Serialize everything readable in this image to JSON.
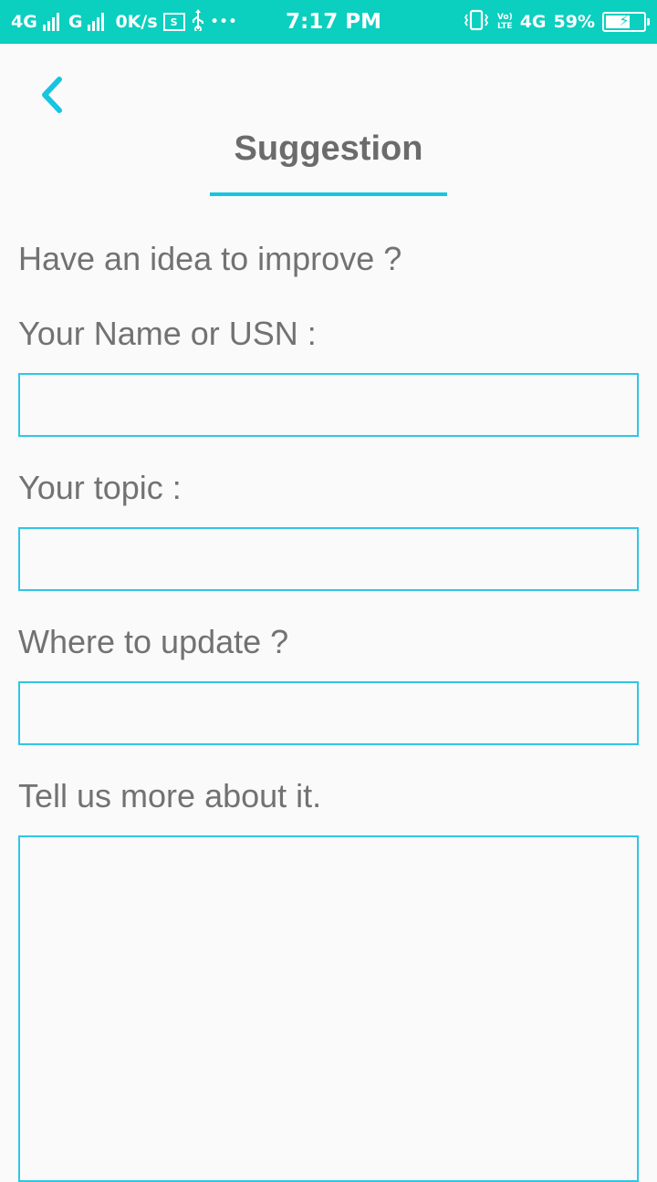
{
  "status_bar": {
    "network1": "4G",
    "network2": "G",
    "speed": "0K/s",
    "sim_label": "S",
    "more": "•••",
    "time": "7:17 PM",
    "volte_top": "Vo)",
    "volte_bottom": "LTE",
    "network3": "4G",
    "battery": "59%"
  },
  "header": {
    "back_icon": "chevron-left-icon",
    "title": "Suggestion",
    "accent_color": "#16c5e0"
  },
  "form": {
    "intro": "Have an idea to improve ?",
    "name_label": "Your Name or USN :",
    "name_value": "",
    "topic_label": "Your topic :",
    "topic_value": "",
    "where_label": "Where to update ?",
    "where_value": "",
    "more_label": "Tell us more about it.",
    "more_value": ""
  }
}
